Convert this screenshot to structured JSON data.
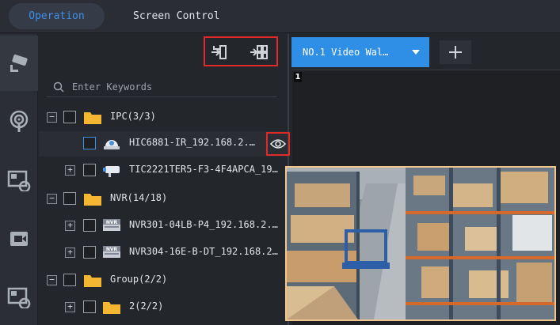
{
  "tabs": {
    "operation": "Operation",
    "screen_control": "Screen Control"
  },
  "rail": {
    "icons": [
      "camera-icon",
      "alarm-icon",
      "video-wall-icon",
      "playback-icon",
      "layout-icon"
    ]
  },
  "toolbar": {
    "icons": [
      "import-icon",
      "add-to-wall-icon"
    ]
  },
  "search": {
    "placeholder": "Enter Keywords"
  },
  "tree": {
    "ipc": {
      "label": "IPC(3/3)"
    },
    "ipc_child_1": {
      "label": "HIC6881-IR_192.168.2.…"
    },
    "ipc_child_2": {
      "label": "TIC2221TER5-F3-4F4APCA_19…"
    },
    "nvr": {
      "label": "NVR(14/18)"
    },
    "nvr_child_1": {
      "label": "NVR301-04LB-P4_192.168.2.…"
    },
    "nvr_child_2": {
      "label": "NVR304-16E-B-DT_192.168.2…"
    },
    "group": {
      "label": "Group(2/2)"
    },
    "group_child_1": {
      "label": "2(2/2)"
    },
    "nvr_badge": "NVR"
  },
  "wall": {
    "tab_label": "NO.1 Video Wal…",
    "screen_number": "1"
  },
  "colors": {
    "accent": "#2f8fe6",
    "highlight": "#e02a2a",
    "folder": "#f5b731"
  }
}
